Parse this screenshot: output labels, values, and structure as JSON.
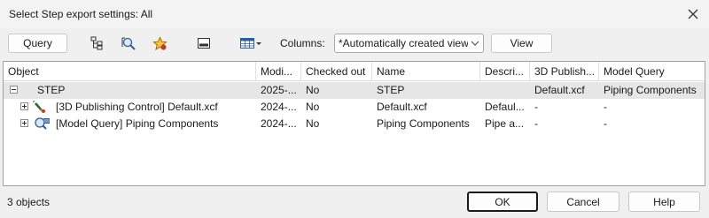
{
  "window": {
    "title": "Select Step export settings: All"
  },
  "toolbar": {
    "query_label": "Query",
    "columns_label": "Columns:",
    "columns_value": "*Automatically created view",
    "view_label": "View"
  },
  "table": {
    "columns": [
      "Object",
      "Modi...",
      "Checked out",
      "Name",
      "Descri...",
      "3D Publish...",
      "Model Query"
    ],
    "rows": [
      {
        "object": "STEP",
        "modified": "2025-...",
        "checked_out": "No",
        "name": "STEP",
        "description": "",
        "publish": "Default.xcf",
        "model_query": "Piping Components"
      },
      {
        "object": "[3D Publishing Control] Default.xcf",
        "modified": "2024-...",
        "checked_out": "No",
        "name": "Default.xcf",
        "description": "Defaul...",
        "publish": "-",
        "model_query": "-"
      },
      {
        "object": "[Model Query] Piping Components",
        "modified": "2024-...",
        "checked_out": "No",
        "name": "Piping Components",
        "description": "Pipe a...",
        "publish": "-",
        "model_query": "-"
      }
    ]
  },
  "status": {
    "count": "3 objects"
  },
  "footer": {
    "ok_label": "OK",
    "cancel_label": "Cancel",
    "help_label": "Help"
  }
}
